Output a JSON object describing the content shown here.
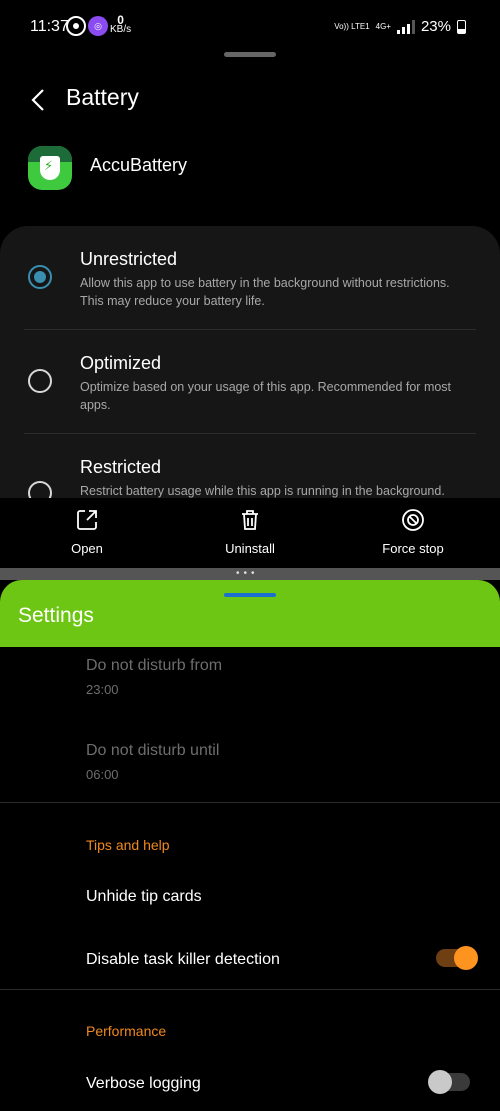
{
  "status_bar": {
    "time": "11:37",
    "speed_value": "0",
    "speed_unit": "KB/s",
    "volte": "Vo)) LTE1",
    "network": "4G+",
    "battery": "23%"
  },
  "header": {
    "title": "Battery"
  },
  "app": {
    "name": "AccuBattery"
  },
  "options": [
    {
      "title": "Unrestricted",
      "description": "Allow this app to use battery in the background without restrictions. This may reduce your battery life.",
      "selected": true
    },
    {
      "title": "Optimized",
      "description": "Optimize based on your usage of this app. Recommended for most apps.",
      "selected": false
    },
    {
      "title": "Restricted",
      "description": "Restrict battery usage while this app is running in the background.",
      "selected": false
    }
  ],
  "actions": {
    "open": "Open",
    "uninstall": "Uninstall",
    "force_stop": "Force stop"
  },
  "settings": {
    "title": "Settings",
    "dnd_from_label": "Do not disturb from",
    "dnd_from_value": "23:00",
    "dnd_until_label": "Do not disturb until",
    "dnd_until_value": "06:00",
    "tips_section": "Tips and help",
    "unhide_tips": "Unhide tip cards",
    "disable_task_killer": "Disable task killer detection",
    "disable_task_killer_on": true,
    "performance_section": "Performance",
    "verbose_logging": "Verbose logging",
    "verbose_logging_on": false
  },
  "colors": {
    "accent_green": "#6dc614",
    "accent_orange": "#f0891e",
    "radio_blue": "#3a8fb0"
  }
}
